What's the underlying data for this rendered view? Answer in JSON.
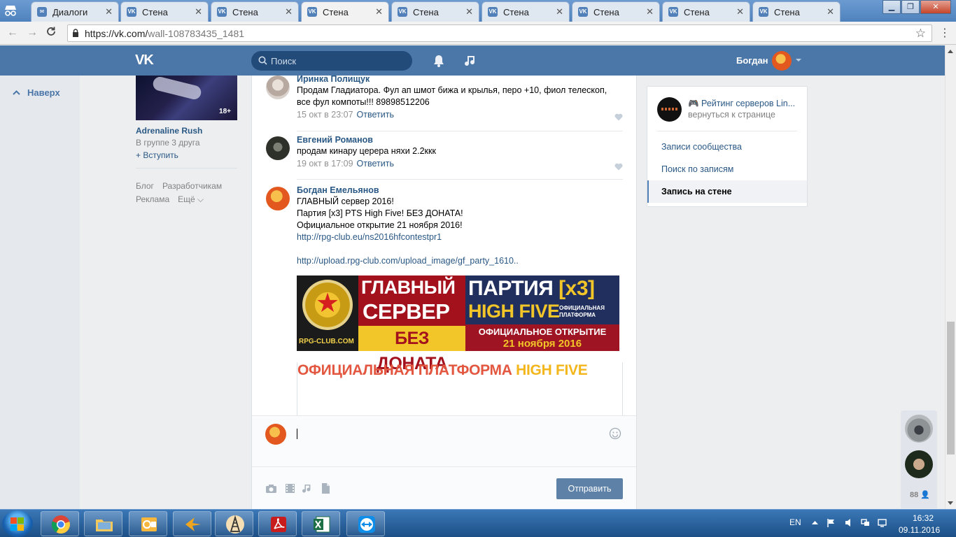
{
  "browser": {
    "tabs": [
      {
        "title": "Диалоги",
        "icon": "vk-messages-icon"
      },
      {
        "title": "Стена",
        "icon": "vk-icon"
      },
      {
        "title": "Стена",
        "icon": "vk-icon"
      },
      {
        "title": "Стена",
        "icon": "vk-icon",
        "active": true
      },
      {
        "title": "Стена",
        "icon": "vk-icon"
      },
      {
        "title": "Стена",
        "icon": "vk-icon"
      },
      {
        "title": "Стена",
        "icon": "vk-icon"
      },
      {
        "title": "Стена",
        "icon": "vk-icon"
      },
      {
        "title": "Стена",
        "icon": "vk-icon"
      }
    ],
    "url_host": "https://vk.com/",
    "url_path": "wall-108783435_1481"
  },
  "header": {
    "logo": "VK",
    "search_placeholder": "Поиск",
    "user_name": "Богдан"
  },
  "left": {
    "to_top": "Наверх",
    "group_age": "18+",
    "group_name": "Adrenaline Rush",
    "group_friends": "В группе 3 друга",
    "group_join": "+ Вступить",
    "links": [
      "Блог",
      "Разработчикам",
      "Реклама",
      "Ещё ⌵"
    ]
  },
  "comments": [
    {
      "author": "Иринка Полищук",
      "text": "Продам Гладиатора. Фул ап шмот бижа и крылья, перо +10, фиол телескоп, все фул компоты!!! 89898512206",
      "time": "15 окт в 23:07",
      "reply": "Ответить"
    },
    {
      "author": "Евгений Романов",
      "text": "продам кинару церера няхи 2.2ккк",
      "time": "19 окт в 17:09",
      "reply": "Ответить"
    },
    {
      "author": "Богдан Емельянов",
      "lines": [
        "ГЛАВНЫЙ сервер 2016!",
        "Партия [x3] PTS High Five! БЕЗ ДОНАТА!",
        "Официальное открытие 21 ноября 2016!"
      ],
      "link1": "http://rpg-club.eu/ns2016hfcontestpr1",
      "link2": "http://upload.rpg-club.com/upload_image/gf_party_1610.."
    }
  ],
  "banner": {
    "site": "RPG-CLUB.COM",
    "l1": "ГЛАВНЫЙ",
    "l2": "СЕРВЕР",
    "l3": "БЕЗ ДОНАТА",
    "party": "ПАРТИЯ ",
    "x3": "[x3]",
    "hf": "HIGH FIVE",
    "platform": "ОФИЦИАЛЬНАЯ ПЛАТФОРМА",
    "opening": "ОФИЦИАЛЬНОЕ ОТКРЫТИЕ",
    "date": "21 ноября 2016"
  },
  "banner2": {
    "title": "ОФИЦИАЛЬНАЯ ПЛАТФОРМА ",
    "hf": "HIGH FIVE"
  },
  "compose": {
    "send_label": "Отправить"
  },
  "side": {
    "group_title": "🎮 Рейтинг серверов Lin...",
    "back": "вернуться к странице",
    "items": [
      {
        "label": "Записи сообщества"
      },
      {
        "label": "Поиск по записям"
      },
      {
        "label": "Запись на стене",
        "selected": true
      }
    ]
  },
  "chat": {
    "count": "88"
  },
  "taskbar": {
    "lang": "EN",
    "time": "16:32",
    "date": "09.11.2016"
  }
}
